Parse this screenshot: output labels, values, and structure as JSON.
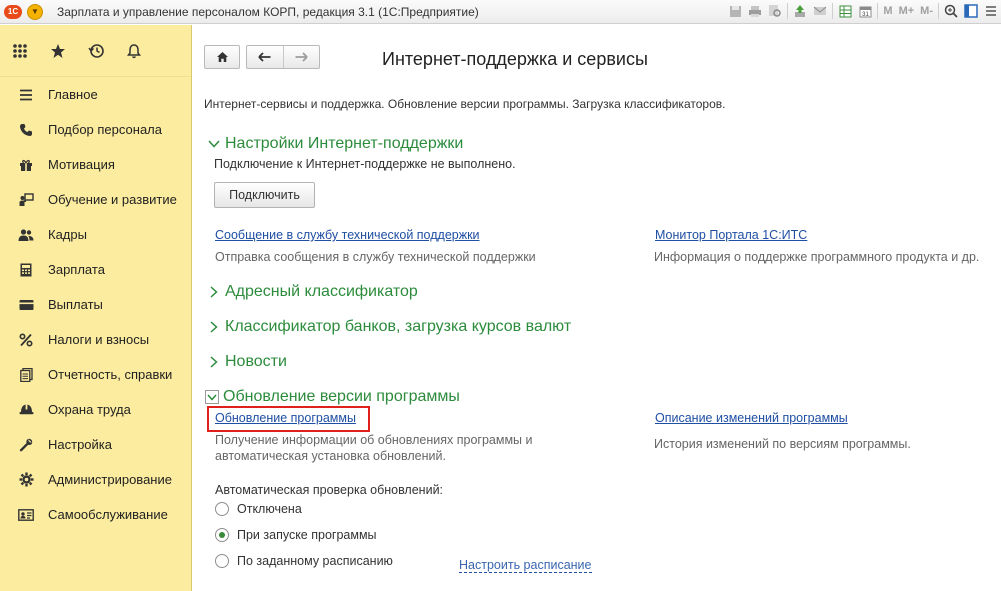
{
  "window": {
    "title": "Зарплата и управление персоналом КОРП, редакция 3.1  (1С:Предприятие)",
    "logo_text": "1С",
    "toolbar_labels": {
      "m": "M",
      "m_plus": "M+",
      "m_minus": "M-"
    }
  },
  "sidebar": {
    "items": [
      {
        "label": "Главное",
        "icon": "menu-lines-icon"
      },
      {
        "label": "Подбор персонала",
        "icon": "phone-icon"
      },
      {
        "label": "Мотивация",
        "icon": "gift-icon"
      },
      {
        "label": "Обучение и развитие",
        "icon": "person-board-icon"
      },
      {
        "label": "Кадры",
        "icon": "people-icon"
      },
      {
        "label": "Зарплата",
        "icon": "calculator-icon"
      },
      {
        "label": "Выплаты",
        "icon": "wallet-icon"
      },
      {
        "label": "Налоги и взносы",
        "icon": "percent-icon"
      },
      {
        "label": "Отчетность, справки",
        "icon": "documents-icon"
      },
      {
        "label": "Охрана труда",
        "icon": "helmet-icon"
      },
      {
        "label": "Настройка",
        "icon": "wrench-icon"
      },
      {
        "label": "Администрирование",
        "icon": "gear-icon"
      },
      {
        "label": "Самообслуживание",
        "icon": "id-card-icon"
      }
    ]
  },
  "page": {
    "title": "Интернет-поддержка и сервисы",
    "description": "Интернет-сервисы и поддержка. Обновление версии программы. Загрузка классификаторов.",
    "sections": {
      "settings": {
        "title": "Настройки Интернет-поддержки",
        "status": "Подключение к Интернет-поддержке не выполнено.",
        "connect_button": "Подключить",
        "support_link": "Сообщение в службу технической поддержки",
        "support_desc": "Отправка сообщения в службу технической поддержки",
        "monitor_link": "Монитор Портала 1С:ИТС",
        "monitor_desc": "Информация о поддержке программного продукта и др."
      },
      "address": {
        "title": "Адресный классификатор"
      },
      "banks": {
        "title": "Классификатор банков, загрузка курсов валют"
      },
      "news": {
        "title": "Новости"
      },
      "update": {
        "title": "Обновление версии программы",
        "update_link": "Обновление программы",
        "update_desc_line1": "Получение информации об обновлениях программы и",
        "update_desc_line2": "автоматическая установка обновлений.",
        "changes_link": "Описание изменений программы",
        "changes_desc": "История изменений по версиям программы.",
        "auto_check_label": "Автоматическая проверка обновлений:",
        "options": [
          {
            "label": "Отключена",
            "selected": false
          },
          {
            "label": "При запуске программы",
            "selected": true
          },
          {
            "label": "По заданному расписанию",
            "selected": false
          }
        ],
        "schedule_link": "Настроить расписание"
      }
    }
  }
}
